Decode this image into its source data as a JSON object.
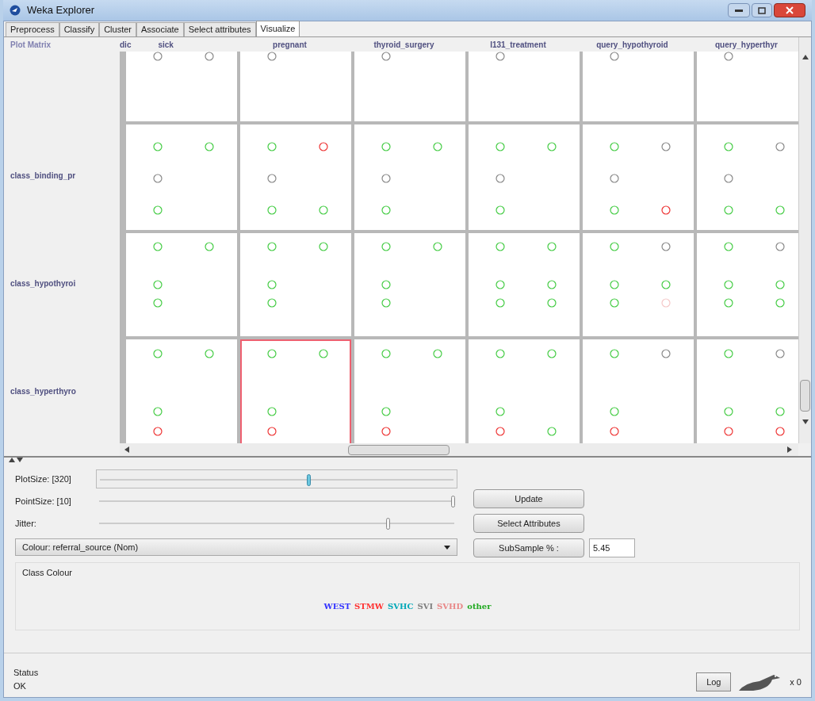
{
  "window": {
    "title": "Weka Explorer"
  },
  "tabs": [
    {
      "label": "Preprocess",
      "selected": false
    },
    {
      "label": "Classify",
      "selected": false
    },
    {
      "label": "Cluster",
      "selected": false
    },
    {
      "label": "Associate",
      "selected": false
    },
    {
      "label": "Select attributes",
      "selected": false
    },
    {
      "label": "Visualize",
      "selected": true
    }
  ],
  "plot_matrix": {
    "title": "Plot Matrix",
    "cut_column_label": "dic",
    "columns": [
      "sick",
      "pregnant",
      "thyroid_surgery",
      "I131_treatment",
      "query_hypothyroid",
      "query_hyperthyr"
    ],
    "rows": [
      {
        "cells": [
          {
            "selected": false
          },
          {
            "selected": false
          },
          {
            "selected": false
          },
          {
            "selected": false
          },
          {
            "selected": false
          },
          {
            "selected": false
          }
        ]
      },
      {
        "label": "class_binding_pr",
        "cells": [
          {
            "selected": false
          },
          {
            "selected": false
          },
          {
            "selected": false
          },
          {
            "selected": false
          },
          {
            "selected": false
          },
          {
            "selected": false
          }
        ]
      },
      {
        "label": "class_hypothyroi",
        "cells": [
          {
            "selected": false
          },
          {
            "selected": false
          },
          {
            "selected": false
          },
          {
            "selected": false
          },
          {
            "selected": false
          },
          {
            "selected": false
          }
        ]
      },
      {
        "label": "class_hyperthyro",
        "cells": [
          {
            "selected": false
          },
          {
            "selected": true
          },
          {
            "selected": false
          },
          {
            "selected": false
          },
          {
            "selected": false
          },
          {
            "selected": false
          }
        ]
      }
    ]
  },
  "sliders": [
    {
      "label": "PlotSize: [320]",
      "level": 0.59,
      "framed": true
    },
    {
      "label": "PointSize: [10]",
      "level": 0.99,
      "framed": false
    },
    {
      "label": "Jitter:",
      "level": 0.81,
      "framed": false
    }
  ],
  "colour_select": {
    "value": "Colour: referral_source (Nom)"
  },
  "buttons": [
    "Update",
    "Select Attributes"
  ],
  "subsample": {
    "button": "SubSample % :",
    "value": "5.45"
  },
  "class_colour": {
    "title": "Class Colour",
    "classes": [
      {
        "name": "WEST",
        "color": "#3333ff"
      },
      {
        "name": "STMW",
        "color": "#ff3333"
      },
      {
        "name": "SVHC",
        "color": "#00a8b8"
      },
      {
        "name": "SVI",
        "color": "#808080"
      },
      {
        "name": "SVHD",
        "color": "#e88888"
      },
      {
        "name": "other",
        "color": "#22aa22"
      }
    ]
  },
  "status": {
    "title": "Status",
    "message": "OK",
    "log_button": "Log",
    "count": "x 0"
  }
}
